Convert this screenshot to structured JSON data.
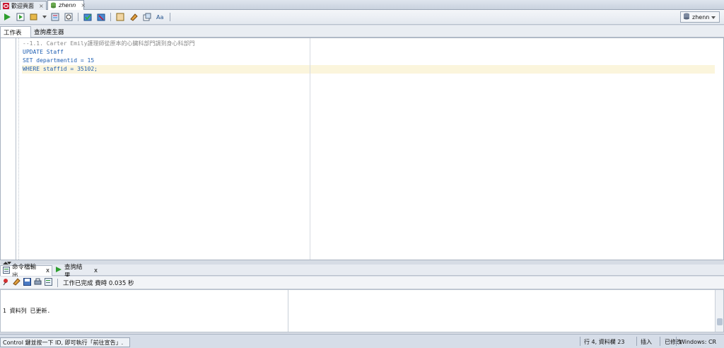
{
  "doc_tabs": [
    {
      "label": "歡迎頁面",
      "close": "×"
    },
    {
      "label": "zhenn",
      "close": "×"
    }
  ],
  "connection": {
    "label": "zhenn"
  },
  "sub_tabs": [
    {
      "label": "工作表"
    },
    {
      "label": "查詢產生器"
    }
  ],
  "editor": {
    "lines": [
      "--1.1. Carter Emily護理師從原本的心臟科部門調到身心科部門",
      "UPDATE Staff",
      "SET departmentid = 15",
      "WHERE staffid = 35102;"
    ]
  },
  "output_tabs": [
    {
      "label": "命令檔輸出",
      "close": "x"
    },
    {
      "label": "查詢結果",
      "close": "x"
    }
  ],
  "output_toolbar": {
    "status": "工作已完成 費時 0.035 秒"
  },
  "output": {
    "text": "1 資料列 已更新."
  },
  "statusbar": {
    "hint": "Control 鍵並按一下 ID, 即可執行「前往宣告」.",
    "position": "行 4, 資料欄 23",
    "mode": "插入",
    "modified": "已修改",
    "line_ending": "Windows: CR"
  },
  "colors": {
    "keyword": "#1f5fb2",
    "comment": "#8a8a8a",
    "number": "#2a7f2a",
    "accent": "#c8102e"
  }
}
